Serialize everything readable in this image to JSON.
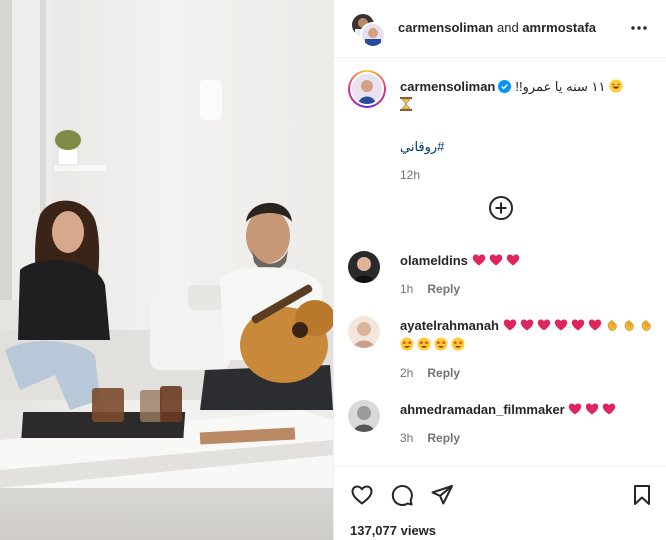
{
  "header": {
    "user1": "carmensoliman",
    "joiner": "and",
    "user2": "amrmostafa"
  },
  "caption": {
    "username": "carmensoliman",
    "text": "١١ سنه يا عمرو!!",
    "hashtag": "#روقاني",
    "time": "12h"
  },
  "comments": [
    {
      "username": "olameldins",
      "time": "1h",
      "reply": "Reply",
      "emojis": [
        "heart",
        "heart",
        "heart"
      ]
    },
    {
      "username": "ayatelrahmanah",
      "time": "2h",
      "reply": "Reply",
      "emojis": [
        "heart",
        "heart",
        "heart",
        "heart",
        "heart",
        "heart",
        "clap",
        "clap",
        "clap",
        "star-eyes",
        "star-eyes",
        "star-eyes",
        "star-eyes"
      ]
    },
    {
      "username": "ahmedramadan_filmmaker",
      "time": "3h",
      "reply": "Reply",
      "emojis": [
        "heart",
        "heart",
        "heart"
      ]
    }
  ],
  "footer": {
    "views": "137,077 views"
  },
  "icons": {
    "more": "more-options-icon",
    "verified": "verified-badge-icon",
    "load_more": "plus-circle-icon",
    "like": "heart-icon",
    "comment": "comment-icon",
    "share": "send-icon",
    "save": "bookmark-icon"
  },
  "colors": {
    "accent_link": "#00376b",
    "verified": "#0095f6",
    "heart": "#e0245e",
    "muted": "#737373"
  }
}
